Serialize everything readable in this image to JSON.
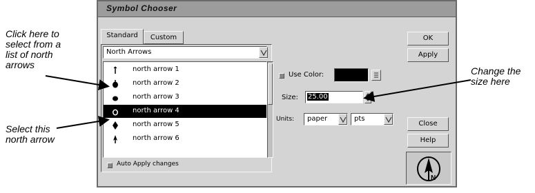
{
  "callouts": {
    "left_top": [
      "Click here to",
      "select from a",
      "list of north",
      "arrows"
    ],
    "left_bottom": [
      "Select this",
      "north arrow"
    ],
    "right": [
      "Change the",
      "size here"
    ]
  },
  "dialog": {
    "title": "Symbol Chooser",
    "tabs": [
      "Standard",
      "Custom"
    ],
    "dropdown_value": "North Arrows",
    "list_items": [
      "north arrow 1",
      "north arrow 2",
      "north arrow 3",
      "north arrow 4",
      "north arrow 5",
      "north arrow 6"
    ],
    "selected_index": 3,
    "use_color_label": "Use Color:",
    "size_label": "Size:",
    "size_value": "25.00",
    "units_label": "Units:",
    "units_value": "paper",
    "units2_value": "pts",
    "buttons": {
      "ok": "OK",
      "apply": "Apply",
      "close": "Close",
      "help": "Help"
    },
    "auto_apply_label": "Auto Apply changes"
  }
}
